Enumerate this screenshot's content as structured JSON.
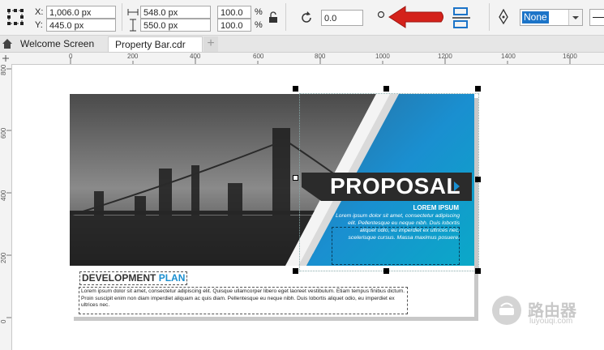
{
  "propbar": {
    "x_label": "X:",
    "x_value": "1,006.0 px",
    "y_label": "Y:",
    "y_value": "445.0 px",
    "width_value": "548.0 px",
    "height_value": "550.0 px",
    "scale_x": "100.0",
    "scale_y": "100.0",
    "percent": "%",
    "rotation_value": "0.0",
    "outline_value": "None"
  },
  "tabs": {
    "welcome": "Welcome Screen",
    "property": "Property Bar.cdr",
    "add": "+"
  },
  "ruler": {
    "h_ticks": [
      "0",
      "200",
      "400",
      "600",
      "800",
      "1000",
      "1200",
      "1400",
      "1600"
    ],
    "v_ticks": [
      "800",
      "600",
      "400",
      "200",
      "0"
    ]
  },
  "document": {
    "proposal": "PROPOSAL",
    "lorem_title": "LOREM IPSUM",
    "lorem_body": "Lorem ipsum dolor sit amet, consectetur adipiscing elit. Pellentesque eu neque nibh. Duis lobortis aliquet odio, eu imperdiet ex ultrices nec, scelerisque cursus. Massa maximus posuere.",
    "dev_word": "DEVELOPMENT",
    "plan_word": "PLAN",
    "dev_body": "Lorem ipsum dolor sit amet, consectetur adipiscing elit. Quisque ullamcorper libero eget laoreet vestibulum. Etiam tempus finibus dictum. Proin suscipit enim non diam imperdiet aliquam ac quis diam. Pellentesque eu neque nibh. Duis lobortis aliquet odio, eu imperdiet ex ultrices nec."
  },
  "watermark": {
    "name": "路由器",
    "url": "luyouqi.com"
  },
  "colors": {
    "accent_blue": "#1a8fd0",
    "cyan": "#1aa6cf",
    "arrow_red": "#d4221b",
    "dark_banner": "#2b2b2b"
  }
}
